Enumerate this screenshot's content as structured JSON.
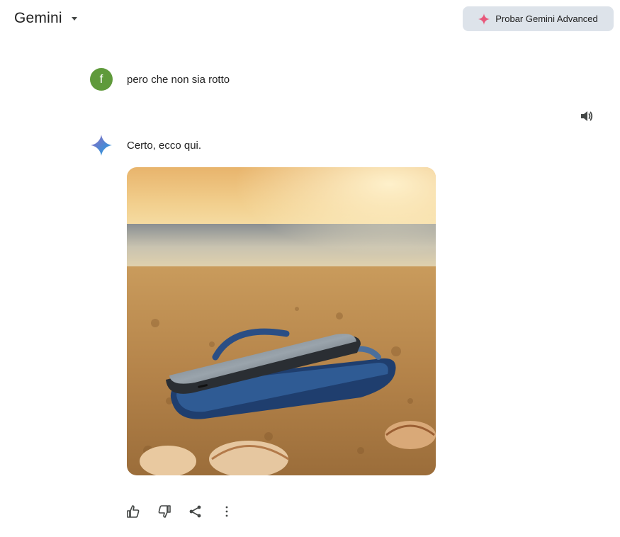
{
  "header": {
    "brand": "Gemini",
    "upgrade_label": "Probar Gemini Advanced"
  },
  "user_message": {
    "avatar_initial": "f",
    "text": "pero che non sia rotto"
  },
  "model_message": {
    "text": "Certo, ecco qui."
  },
  "colors": {
    "avatar": "#5f9a3b",
    "upgrade_bg": "#dde3ea",
    "spark_pink": "#e8577a",
    "gemini_blue": "#4a7ee8"
  },
  "icons": {
    "brand_caret": "caret-down-icon",
    "upgrade": "sparkle-icon",
    "speaker": "speaker-icon",
    "like": "thumbs-up-icon",
    "dislike": "thumbs-down-icon",
    "share": "share-icon",
    "more": "more-vert-icon"
  }
}
